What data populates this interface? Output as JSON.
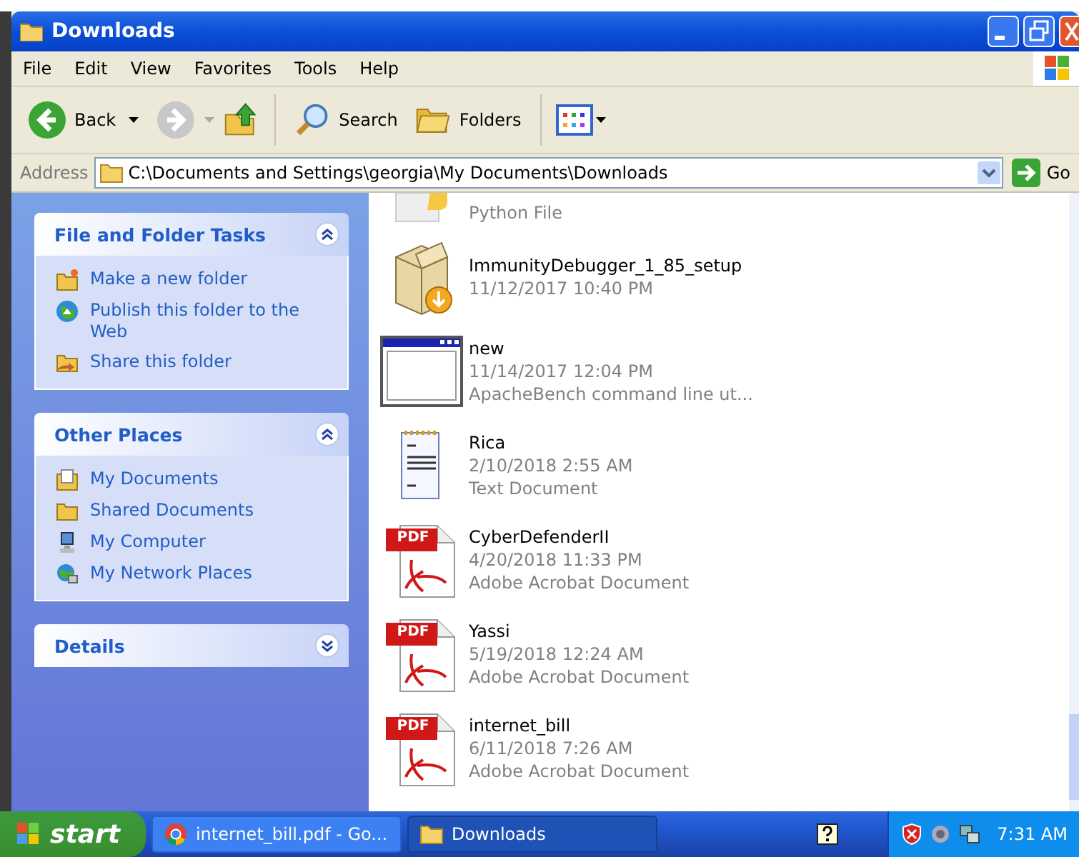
{
  "window": {
    "title": "Downloads"
  },
  "menu": [
    "File",
    "Edit",
    "View",
    "Favorites",
    "Tools",
    "Help"
  ],
  "toolbar": {
    "back": "Back",
    "search": "Search",
    "folders": "Folders"
  },
  "address": {
    "label": "Address",
    "value": "C:\\Documents and Settings\\georgia\\My Documents\\Downloads",
    "go": "Go"
  },
  "sidebar": [
    {
      "title": "File and Folder Tasks",
      "expanded": true,
      "items": [
        {
          "kind": "newfolder",
          "label": "Make a new folder"
        },
        {
          "kind": "publish",
          "label": "Publish this folder to the Web"
        },
        {
          "kind": "share",
          "label": "Share this folder"
        }
      ]
    },
    {
      "title": "Other Places",
      "expanded": true,
      "items": [
        {
          "kind": "documents",
          "label": "My Documents"
        },
        {
          "kind": "folder",
          "label": "Shared Documents"
        },
        {
          "kind": "computer",
          "label": "My Computer"
        },
        {
          "kind": "network",
          "label": "My Network Places"
        }
      ]
    },
    {
      "title": "Details",
      "expanded": false
    }
  ],
  "files": [
    {
      "kind": "python",
      "type": "Python File"
    },
    {
      "kind": "installer",
      "name": "ImmunityDebugger_1_85_setup",
      "date": "11/12/2017 10:40 PM"
    },
    {
      "kind": "app",
      "name": "new",
      "date": "11/14/2017 12:04 PM",
      "type": "ApacheBench command line ut..."
    },
    {
      "kind": "text",
      "name": "Rica",
      "date": "2/10/2018 2:55 AM",
      "type": "Text Document"
    },
    {
      "kind": "pdf",
      "badge": "PDF",
      "name": "CyberDefenderII",
      "date": "4/20/2018 11:33 PM",
      "type": "Adobe Acrobat Document"
    },
    {
      "kind": "pdf",
      "badge": "PDF",
      "name": "Yassi",
      "date": "5/19/2018 12:24 AM",
      "type": "Adobe Acrobat Document"
    },
    {
      "kind": "pdf",
      "badge": "PDF",
      "name": "internet_bill",
      "date": "6/11/2018 7:26 AM",
      "type": "Adobe Acrobat Document"
    }
  ],
  "taskbar": {
    "start": "start",
    "buttons": [
      {
        "kind": "chrome",
        "label": "internet_bill.pdf - Go...",
        "selected": false
      },
      {
        "kind": "folder",
        "label": "Downloads",
        "selected": true
      }
    ],
    "clock": "7:31 AM"
  }
}
